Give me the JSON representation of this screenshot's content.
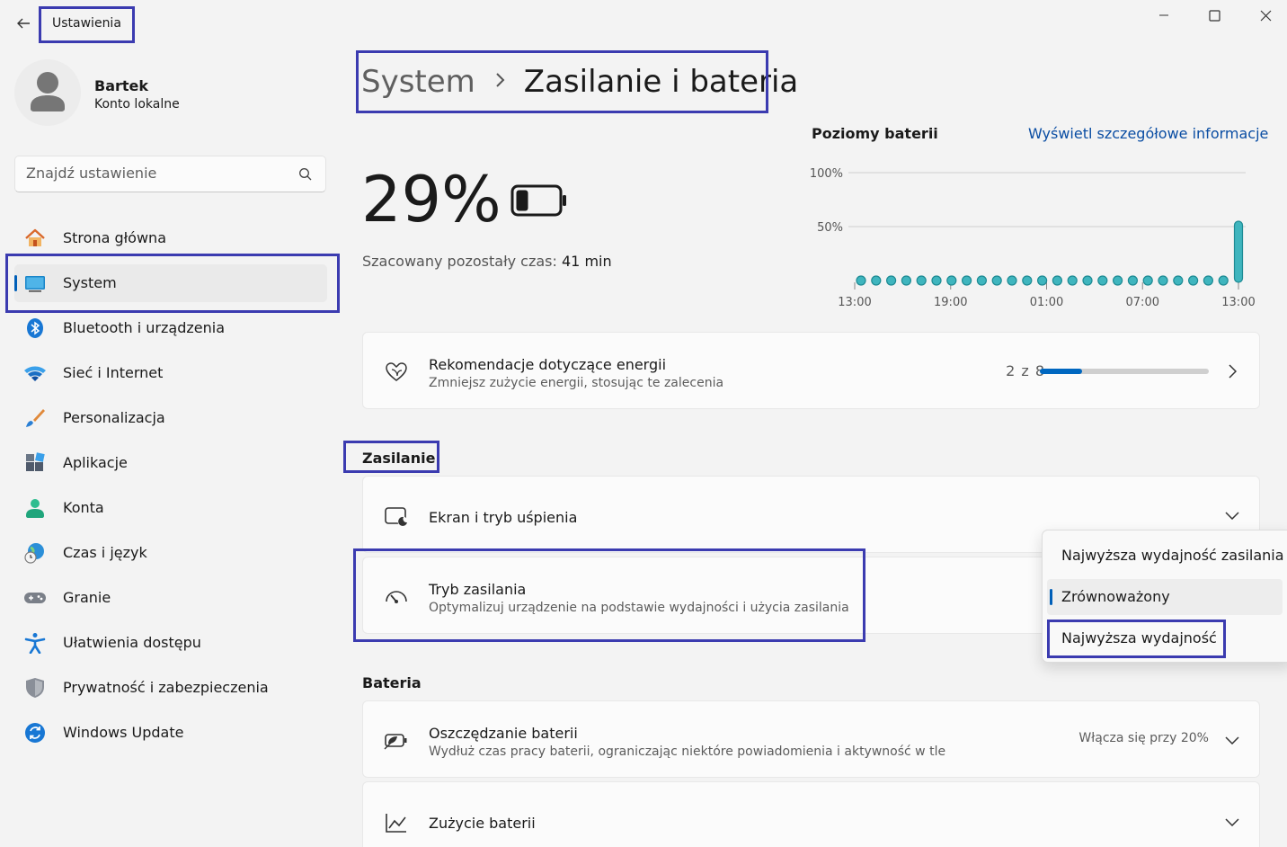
{
  "window": {
    "title": "Ustawienia"
  },
  "profile": {
    "name": "Bartek",
    "account_type": "Konto lokalne"
  },
  "search": {
    "placeholder": "Znajdź ustawienie"
  },
  "sidebar": {
    "items": [
      {
        "label": "Strona główna",
        "icon": "home-icon"
      },
      {
        "label": "System",
        "icon": "system-icon",
        "selected": true
      },
      {
        "label": "Bluetooth i urządzenia",
        "icon": "bluetooth-icon"
      },
      {
        "label": "Sieć i Internet",
        "icon": "wifi-icon"
      },
      {
        "label": "Personalizacja",
        "icon": "brush-icon"
      },
      {
        "label": "Aplikacje",
        "icon": "apps-icon"
      },
      {
        "label": "Konta",
        "icon": "account-icon"
      },
      {
        "label": "Czas i język",
        "icon": "globe-clock-icon"
      },
      {
        "label": "Granie",
        "icon": "gamepad-icon"
      },
      {
        "label": "Ułatwienia dostępu",
        "icon": "accessibility-icon"
      },
      {
        "label": "Prywatność i zabezpieczenia",
        "icon": "shield-icon"
      },
      {
        "label": "Windows Update",
        "icon": "update-icon"
      }
    ]
  },
  "breadcrumb": {
    "parent": "System",
    "current": "Zasilanie i bateria"
  },
  "battery": {
    "percent": "29%",
    "level": 0.29,
    "estimate_label": "Szacowany pozostały czas:",
    "estimate_value": "41 min"
  },
  "chart_data": {
    "type": "scatter",
    "title": "Poziomy baterii",
    "link": "Wyświetl szczegółowe informacje",
    "y_tick_labels": [
      "100%",
      "50%"
    ],
    "x_tick_labels": [
      "13:00",
      "19:00",
      "01:00",
      "07:00",
      "13:00"
    ],
    "ylim": [
      0,
      100
    ],
    "values": [
      0,
      0,
      0,
      0,
      0,
      0,
      0,
      0,
      0,
      0,
      0,
      0,
      0,
      0,
      0,
      0,
      0,
      0,
      0,
      0,
      0,
      0,
      0,
      0,
      0,
      55
    ],
    "last_bar": {
      "from": 0,
      "to": 55
    }
  },
  "energy_card": {
    "title": "Rekomendacje dotyczące energii",
    "subtitle": "Zmniejsz zużycie energii, stosując te zalecenia",
    "progress_text": "2 z 8",
    "progress": 0.25
  },
  "sections": {
    "power": "Zasilanie",
    "battery": "Bateria"
  },
  "screen_sleep_card": {
    "title": "Ekran i tryb uśpienia"
  },
  "power_mode_card": {
    "title": "Tryb zasilania",
    "subtitle": "Optymalizuj urządzenie na podstawie wydajności i użycia zasilania"
  },
  "power_mode_dropdown": {
    "options": [
      "Najwyższa wydajność zasilania",
      "Zrównoważony",
      "Najwyższa wydajność"
    ],
    "selected": "Zrównoważony"
  },
  "battery_saver_card": {
    "title": "Oszczędzanie baterii",
    "subtitle": "Wydłuż czas pracy baterii, ograniczając niektóre powiadomienia i aktywność w tle",
    "value": "Włącza się przy 20%"
  },
  "battery_usage_card": {
    "title": "Zużycie baterii"
  },
  "colors": {
    "accent": "#005fb8",
    "chart_teal": "#3fb5be",
    "highlight": "#3b3bb0"
  }
}
